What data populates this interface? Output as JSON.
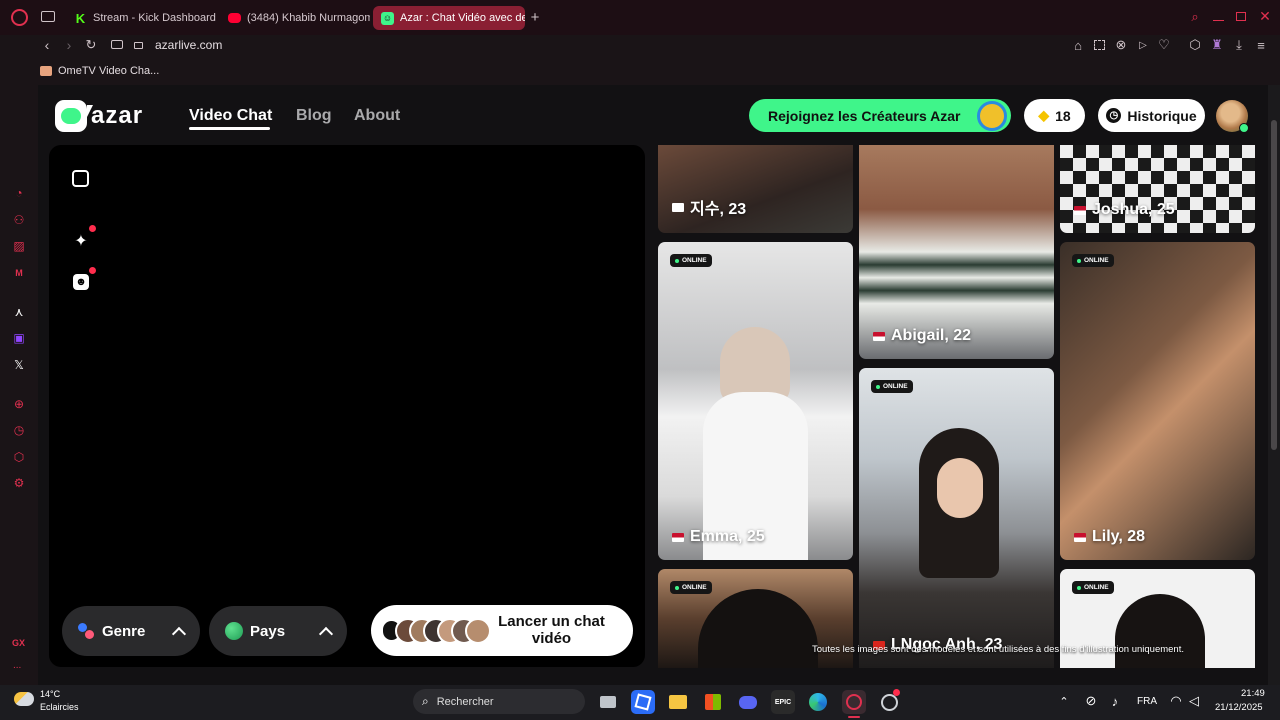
{
  "browser": {
    "tabs": [
      {
        "title": "Stream - Kick Dashboard",
        "active": false
      },
      {
        "title": "(3484) Khabib Nurmagom",
        "active": false
      },
      {
        "title": "Azar : Chat Vidéo avec de",
        "active": true
      }
    ],
    "new_tab": "+",
    "address": "azarlive.com",
    "bookmark": "OmeTV Video Cha...",
    "sidebar_label": "GX",
    "sidebar_more": "..."
  },
  "site": {
    "logo": "azar",
    "nav": [
      "Video Chat",
      "Blog",
      "About"
    ],
    "creators_cta": "Rejoignez les Créateurs Azar",
    "gems": "18",
    "history": "Historique",
    "accent": "#3ff58a"
  },
  "profiles": [
    {
      "name": "지수, 23",
      "online": false
    },
    {
      "name": "Abigail, 22",
      "online": false
    },
    {
      "name": "Joshua, 25",
      "online": false
    },
    {
      "name": "Emma, 25",
      "online": true
    },
    {
      "name": "Lily, 28",
      "online": true
    },
    {
      "name": "LNgọc Anh, 23",
      "online": true
    },
    {
      "name": "",
      "online": true
    },
    {
      "name": "",
      "online": true
    }
  ],
  "online_label": "ONLINE",
  "disclaimer": "Toutes les images sont des modèles et sont utilisées à des fins d'illustration uniquement.",
  "filters": {
    "gender": "Genre",
    "country": "Pays"
  },
  "start_chat": "Lancer un chat vidéo",
  "taskbar": {
    "temperature": "14°C",
    "weather": "Eclaircies",
    "search": "Rechercher",
    "lang": "FRA",
    "time": "21:49",
    "date": "21/12/2025",
    "epic_label": "EPIC"
  }
}
